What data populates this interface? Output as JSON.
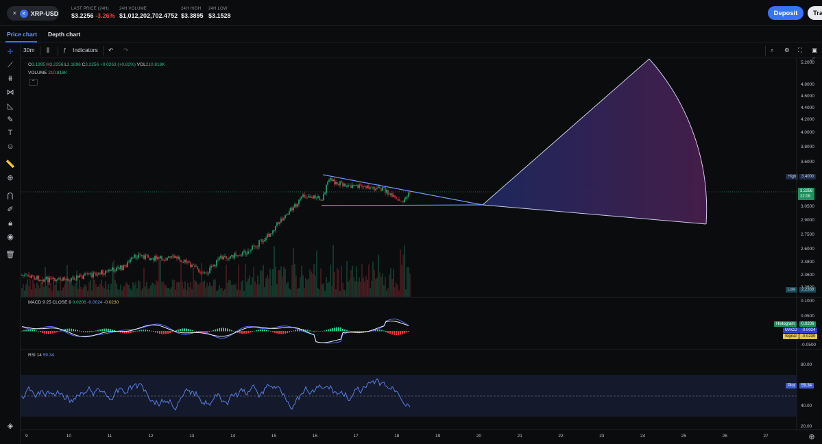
{
  "header": {
    "pair": "XRP-USD",
    "last_price_label": "LAST PRICE (24H)",
    "last_price": "$3.2256",
    "change": "-3.26%",
    "volume_label": "24H VOLUME",
    "volume": "$1,012,202,702.4752",
    "high_label": "24H HIGH",
    "high": "$3.3895",
    "low_label": "24H LOW",
    "low": "$3.1528",
    "deposit_label": "Deposit",
    "trade_label": "Tra"
  },
  "tabs": {
    "price_chart": "Price chart",
    "depth_chart": "Depth chart"
  },
  "toolbar": {
    "interval": "30m",
    "indicators": "Indicators"
  },
  "legend": {
    "ohlc_o_key": "O",
    "ohlc_o": "3.1995",
    "ohlc_h_key": "H",
    "ohlc_h": "3.2256",
    "ohlc_l_key": "L",
    "ohlc_l": "3.1896",
    "ohlc_c_key": "C",
    "ohlc_c": "3.2256",
    "ohlc_change": "+0.0263 (+0.82%)",
    "vol_key": "VOL",
    "vol": "210.818K",
    "volume_label": "VOLUME",
    "volume_value": "210.818K",
    "macd_label": "MACD 9 25 CLOSE 9",
    "macd_hist": "0.0206",
    "macd_macd": "-0.0024",
    "macd_signal": "-0.0230",
    "rsi_label": "RSI 14",
    "rsi_value": "59.34"
  },
  "tags": {
    "high_label": "High",
    "high_value": "3.4000",
    "price_value": "3.2256",
    "price_time": "22:09",
    "low_label": "Low",
    "low_value": "2.2338",
    "histogram_label": "Histogram",
    "histogram_value": "0.0206",
    "macd_label": "MACD",
    "macd_value": "-0.0024",
    "signal_label": "Signal",
    "signal_value": "-0.0230",
    "plot_label": "Plot",
    "plot_value": "59.34"
  },
  "chart_data": {
    "type": "candlestick",
    "price_axis_ticks": [
      "5.2000",
      "4.8000",
      "4.6000",
      "4.4000",
      "4.2000",
      "4.0000",
      "3.8000",
      "3.6000",
      "3.4000",
      "3.0500",
      "2.9000",
      "2.7500",
      "2.6000",
      "2.4800",
      "2.3600",
      "2.2600"
    ],
    "macd_axis_ticks": [
      "0.1000",
      "0.0500",
      "-0.0500"
    ],
    "rsi_axis_ticks": [
      "80.00",
      "60.00",
      "40.00",
      "20.00"
    ],
    "x_ticks": [
      "9",
      "10",
      "11",
      "12",
      "13",
      "14",
      "15",
      "16",
      "17",
      "18",
      "19",
      "20",
      "21",
      "22",
      "23",
      "24",
      "25",
      "26",
      "27"
    ],
    "colors": {
      "up": "#26c281",
      "down": "#ea3943",
      "accent": "#3773f5",
      "drawing": "#6f9bff"
    }
  }
}
